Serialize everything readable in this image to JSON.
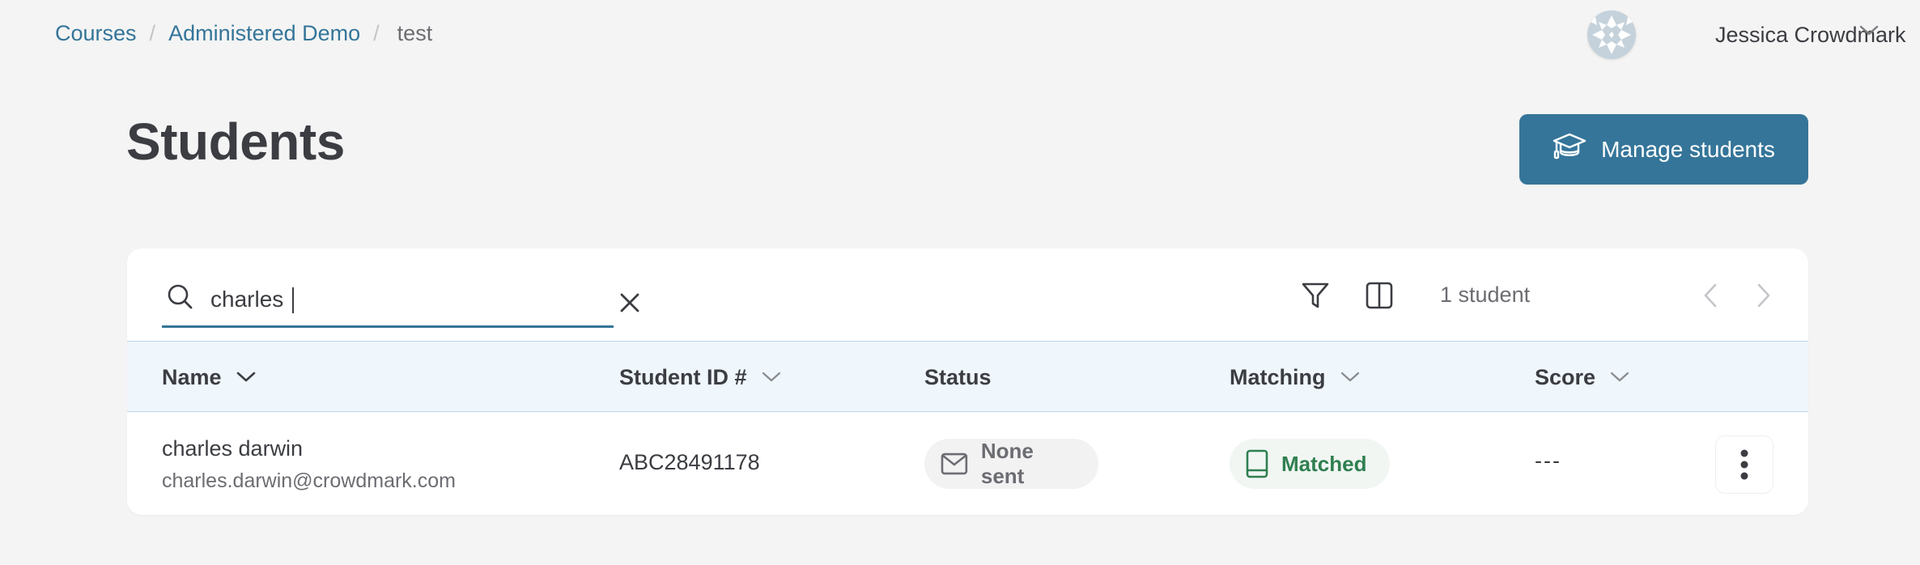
{
  "breadcrumb": {
    "items": [
      {
        "label": "Courses",
        "link": true
      },
      {
        "label": "Administered Demo",
        "link": true
      },
      {
        "label": "test",
        "link": false
      }
    ],
    "separator": "/"
  },
  "user": {
    "name": "Jessica Crowdmark",
    "avatar_icon": "identicon-avatar",
    "menu_icon": "chevron-down-icon"
  },
  "page": {
    "title": "Students",
    "primary_action": {
      "label": "Manage students",
      "icon": "graduation-cap-icon"
    }
  },
  "toolbar": {
    "search": {
      "value": "charles",
      "placeholder": "",
      "icon": "search-icon",
      "clear_icon": "close-icon"
    },
    "filter_icon": "filter-icon",
    "columns_icon": "columns-icon",
    "result_count": "1 student",
    "pagination": {
      "prev_icon": "chevron-left-icon",
      "next_icon": "chevron-right-icon"
    }
  },
  "table": {
    "columns": [
      {
        "label": "Name",
        "sortable": true,
        "active_sort": true
      },
      {
        "label": "Student ID #",
        "sortable": true,
        "active_sort": false
      },
      {
        "label": "Status",
        "sortable": false,
        "active_sort": false
      },
      {
        "label": "Matching",
        "sortable": true,
        "active_sort": false
      },
      {
        "label": "Score",
        "sortable": true,
        "active_sort": false
      }
    ],
    "rows": [
      {
        "name": "charles darwin",
        "email": "charles.darwin@crowdmark.com",
        "student_id": "ABC28491178",
        "status": {
          "label": "None sent",
          "icon": "envelope-icon"
        },
        "matching": {
          "label": "Matched",
          "icon": "book-icon"
        },
        "score": "---",
        "actions_icon": "more-vertical-icon"
      }
    ]
  },
  "colors": {
    "brand": "#357599",
    "link": "#347599",
    "matched_green": "#2f7f50",
    "header_bg": "#eff6fc",
    "page_bg": "#f4f4f4"
  }
}
